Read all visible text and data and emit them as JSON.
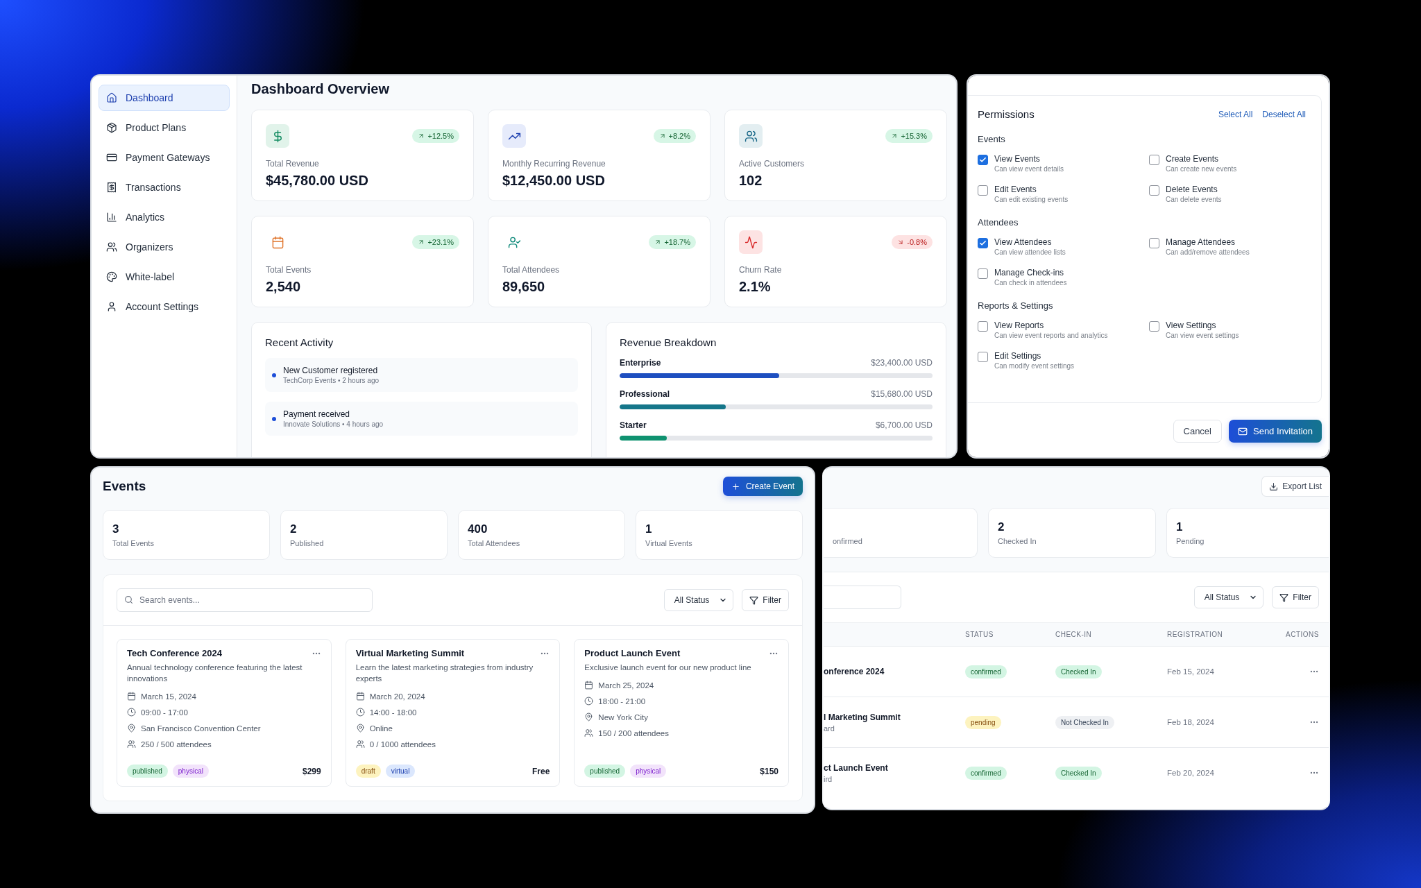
{
  "dashboard": {
    "sidebar": [
      {
        "label": "Dashboard",
        "selected": true
      },
      {
        "label": "Product Plans",
        "selected": false
      },
      {
        "label": "Payment Gateways",
        "selected": false
      },
      {
        "label": "Transactions",
        "selected": false
      },
      {
        "label": "Analytics",
        "selected": false
      },
      {
        "label": "Organizers",
        "selected": false
      },
      {
        "label": "White-label",
        "selected": false
      },
      {
        "label": "Account Settings",
        "selected": false
      }
    ],
    "title": "Dashboard Overview",
    "stats": [
      {
        "label": "Total Revenue",
        "value": "$45,780.00 USD",
        "change": "+12.5%",
        "kind": "up"
      },
      {
        "label": "Monthly Recurring Revenue",
        "value": "$12,450.00 USD",
        "change": "+8.2%",
        "kind": "up"
      },
      {
        "label": "Active Customers",
        "value": "102",
        "change": "+15.3%",
        "kind": "up"
      },
      {
        "label": "Total Events",
        "value": "2,540",
        "change": "+23.1%",
        "kind": "up"
      },
      {
        "label": "Total Attendees",
        "value": "89,650",
        "change": "+18.7%",
        "kind": "up"
      },
      {
        "label": "Churn Rate",
        "value": "2.1%",
        "change": "-0.8%",
        "kind": "down"
      }
    ],
    "recent_activity": {
      "title": "Recent Activity",
      "items": [
        {
          "title": "New Customer registered",
          "meta": "TechCorp Events • 2 hours ago"
        },
        {
          "title": "Payment received",
          "meta": "Innovate Solutions • 4 hours ago"
        }
      ]
    },
    "revenue_breakdown": {
      "title": "Revenue Breakdown",
      "rows": [
        {
          "label": "Enterprise",
          "amount": "$23,400.00 USD",
          "level": 0.51,
          "color": "#1e4fc0"
        },
        {
          "label": "Professional",
          "amount": "$15,680.00 USD",
          "level": 0.34,
          "color": "#15768a"
        },
        {
          "label": "Starter",
          "amount": "$6,700.00 USD",
          "level": 0.15,
          "color": "#0f9270"
        }
      ]
    }
  },
  "permissions": {
    "title": "Permissions",
    "actions": [
      "Select All",
      "Deselect All"
    ],
    "groups": [
      {
        "title": "Events",
        "items": [
          {
            "label": "View Events",
            "description": "Can view event details",
            "checked": true
          },
          {
            "label": "Create Events",
            "description": "Can create new events",
            "checked": false
          },
          {
            "label": "Edit Events",
            "description": "Can edit existing events",
            "checked": false
          },
          {
            "label": "Delete Events",
            "description": "Can delete events",
            "checked": false
          }
        ]
      },
      {
        "title": "Attendees",
        "items": [
          {
            "label": "View Attendees",
            "description": "Can view attendee lists",
            "checked": true
          },
          {
            "label": "Manage Attendees",
            "description": "Can add/remove attendees",
            "checked": false
          },
          {
            "label": "Manage Check-ins",
            "description": "Can check in attendees",
            "checked": false
          }
        ]
      },
      {
        "title": "Reports & Settings",
        "items": [
          {
            "label": "View Reports",
            "description": "Can view event reports and analytics",
            "checked": false
          },
          {
            "label": "View Settings",
            "description": "Can view event settings",
            "checked": false
          },
          {
            "label": "Edit Settings",
            "description": "Can modify event settings",
            "checked": false
          }
        ]
      }
    ],
    "cancel_button": "Cancel",
    "send_button": "Send Invitation"
  },
  "events": {
    "title": "Events",
    "create_button": "Create Event",
    "stats": [
      {
        "value": "3",
        "label": "Total Events"
      },
      {
        "value": "2",
        "label": "Published"
      },
      {
        "value": "400",
        "label": "Total Attendees"
      },
      {
        "value": "1",
        "label": "Virtual Events"
      }
    ],
    "search": {
      "placeholder": "Search events..."
    },
    "status_select": "All Status",
    "filter_button": "Filter",
    "cards": [
      {
        "title": "Tech Conference 2024",
        "description": "Annual technology conference featuring the latest innovations",
        "date": "March 15, 2024",
        "time": "09:00 - 17:00",
        "location": "San Francisco Convention Center",
        "attendees": "250 / 500 attendees",
        "tags": [
          {
            "label": "published",
            "kind": "green"
          },
          {
            "label": "physical",
            "kind": "purple"
          }
        ],
        "price": "$299"
      },
      {
        "title": "Virtual Marketing Summit",
        "description": "Learn the latest marketing strategies from industry experts",
        "date": "March 20, 2024",
        "time": "14:00 - 18:00",
        "location": "Online",
        "attendees": "0 / 1000 attendees",
        "tags": [
          {
            "label": "draft",
            "kind": "yellow"
          },
          {
            "label": "virtual",
            "kind": "blue"
          }
        ],
        "price": "Free"
      },
      {
        "title": "Product Launch Event",
        "description": "Exclusive launch event for our new product line",
        "date": "March 25, 2024",
        "time": "18:00 - 21:00",
        "location": "New York City",
        "attendees": "150 / 200 attendees",
        "tags": [
          {
            "label": "published",
            "kind": "green"
          },
          {
            "label": "physical",
            "kind": "purple"
          }
        ],
        "price": "$150"
      }
    ]
  },
  "attendees": {
    "export_button": "Export List",
    "stats": [
      {
        "label": "onfirmed"
      },
      {
        "value": "2",
        "label": "Checked In"
      },
      {
        "value": "1",
        "label": "Pending"
      }
    ],
    "status_select": "All Status",
    "filter_button": "Filter",
    "columns": [
      "STATUS",
      "CHECK-IN",
      "REGISTRATION",
      "ACTIONS"
    ],
    "rows": [
      {
        "event": "onference 2024",
        "status": {
          "label": "confirmed",
          "kind": "green"
        },
        "checkin": {
          "label": "Checked In",
          "kind": "green"
        },
        "registration": "Feb 15, 2024"
      },
      {
        "event": "l Marketing Summit",
        "detail": "ard",
        "status": {
          "label": "pending",
          "kind": "yellow"
        },
        "checkin": {
          "label": "Not Checked In",
          "kind": "gray"
        },
        "registration": "Feb 18, 2024"
      },
      {
        "event": "ct Launch Event",
        "detail": "ird",
        "status": {
          "label": "confirmed",
          "kind": "green"
        },
        "checkin": {
          "label": "Checked In",
          "kind": "green"
        },
        "registration": "Feb 20, 2024"
      }
    ]
  }
}
